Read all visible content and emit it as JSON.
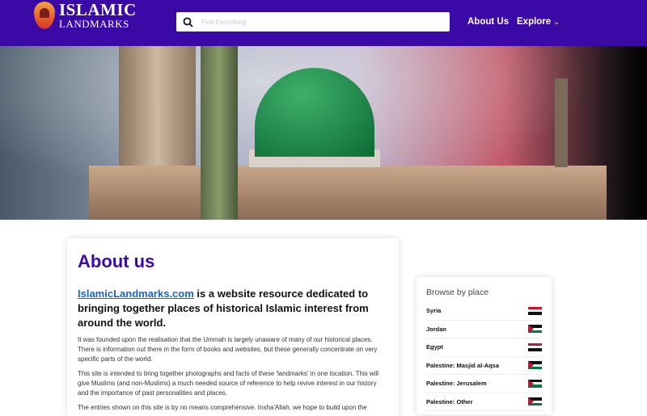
{
  "header": {
    "logo_line1": "ISLAMIC",
    "logo_line2": "LANDMARKS",
    "search_placeholder": "Find Everything",
    "nav": [
      {
        "label": "About Us"
      },
      {
        "label": "Explore"
      }
    ]
  },
  "main": {
    "title": "About us",
    "lead_link": "IslamicLandmarks.com",
    "lead_rest": " is a website resource dedicated to bringing together places of historical Islamic interest from around the world.",
    "paragraphs": [
      "It was founded upon the realisation that the Ummah is largely unaware of many of our historical places. There is information out there in the form of books and websites, but these generally concentrate on very specific parts of the world.",
      "This site is intended to bring together photographs and facts of these 'landmarks' in one location. This will give Muslims (and non-Muslims) a much needed source of reference to help revive interest in our history and the importance of past personalities and places.",
      "The entries shown on this site is by no means comprehensive. Insha'Allah, we hope to build upon the"
    ]
  },
  "sidebar": {
    "title": "Browse by place",
    "places": [
      {
        "label": "Syria",
        "flag": "syria"
      },
      {
        "label": "Jordan",
        "flag": "jordan"
      },
      {
        "label": "Egypt",
        "flag": "egypt"
      },
      {
        "label": "Palestine: Masjid al-Aqsa",
        "flag": "palestine"
      },
      {
        "label": "Palestine: Jerusalem",
        "flag": "palestine"
      },
      {
        "label": "Palestine: Other",
        "flag": "palestine"
      }
    ]
  },
  "colors": {
    "brand": "#3b0aa6",
    "accent": "#f6a03a",
    "link": "#1a64c8"
  }
}
